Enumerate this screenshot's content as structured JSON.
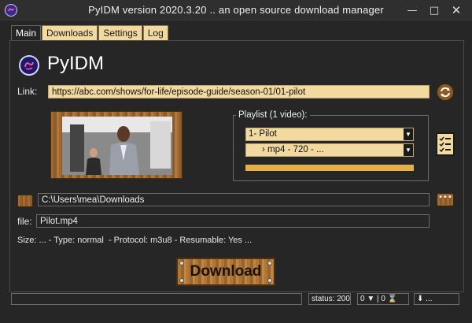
{
  "window": {
    "title": "PyIDM version 2020.3.20 .. an open source download manager"
  },
  "tabs": [
    {
      "label": "Main"
    },
    {
      "label": "Downloads"
    },
    {
      "label": "Settings"
    },
    {
      "label": "Log"
    }
  ],
  "main": {
    "app_name": "PyIDM",
    "link_label": "Link:",
    "link_value": "https://abc.com/shows/for-life/episode-guide/season-01/01-pilot",
    "playlist": {
      "title": "Playlist (1 video):",
      "selected_video": "1- Pilot",
      "selected_stream": "› mp4 - 720 - ...",
      "progress": 1.0
    },
    "folder_value": "C:\\Users\\mea\\Downloads",
    "file_label": "file:",
    "file_value": "Pilot.mp4",
    "info_line": "Size: ... - Type: normal  - Protocol: m3u8 - Resumable: Yes ...",
    "download_label": "Download"
  },
  "statusbar": {
    "status": "status: 200",
    "counters": "0 ▼  |  0 ⌛",
    "speed": "⬇ ..."
  },
  "colors": {
    "accent": "#f1d9a0",
    "background": "#262626",
    "wood": "#a06a32",
    "progress": "#e4b045"
  }
}
